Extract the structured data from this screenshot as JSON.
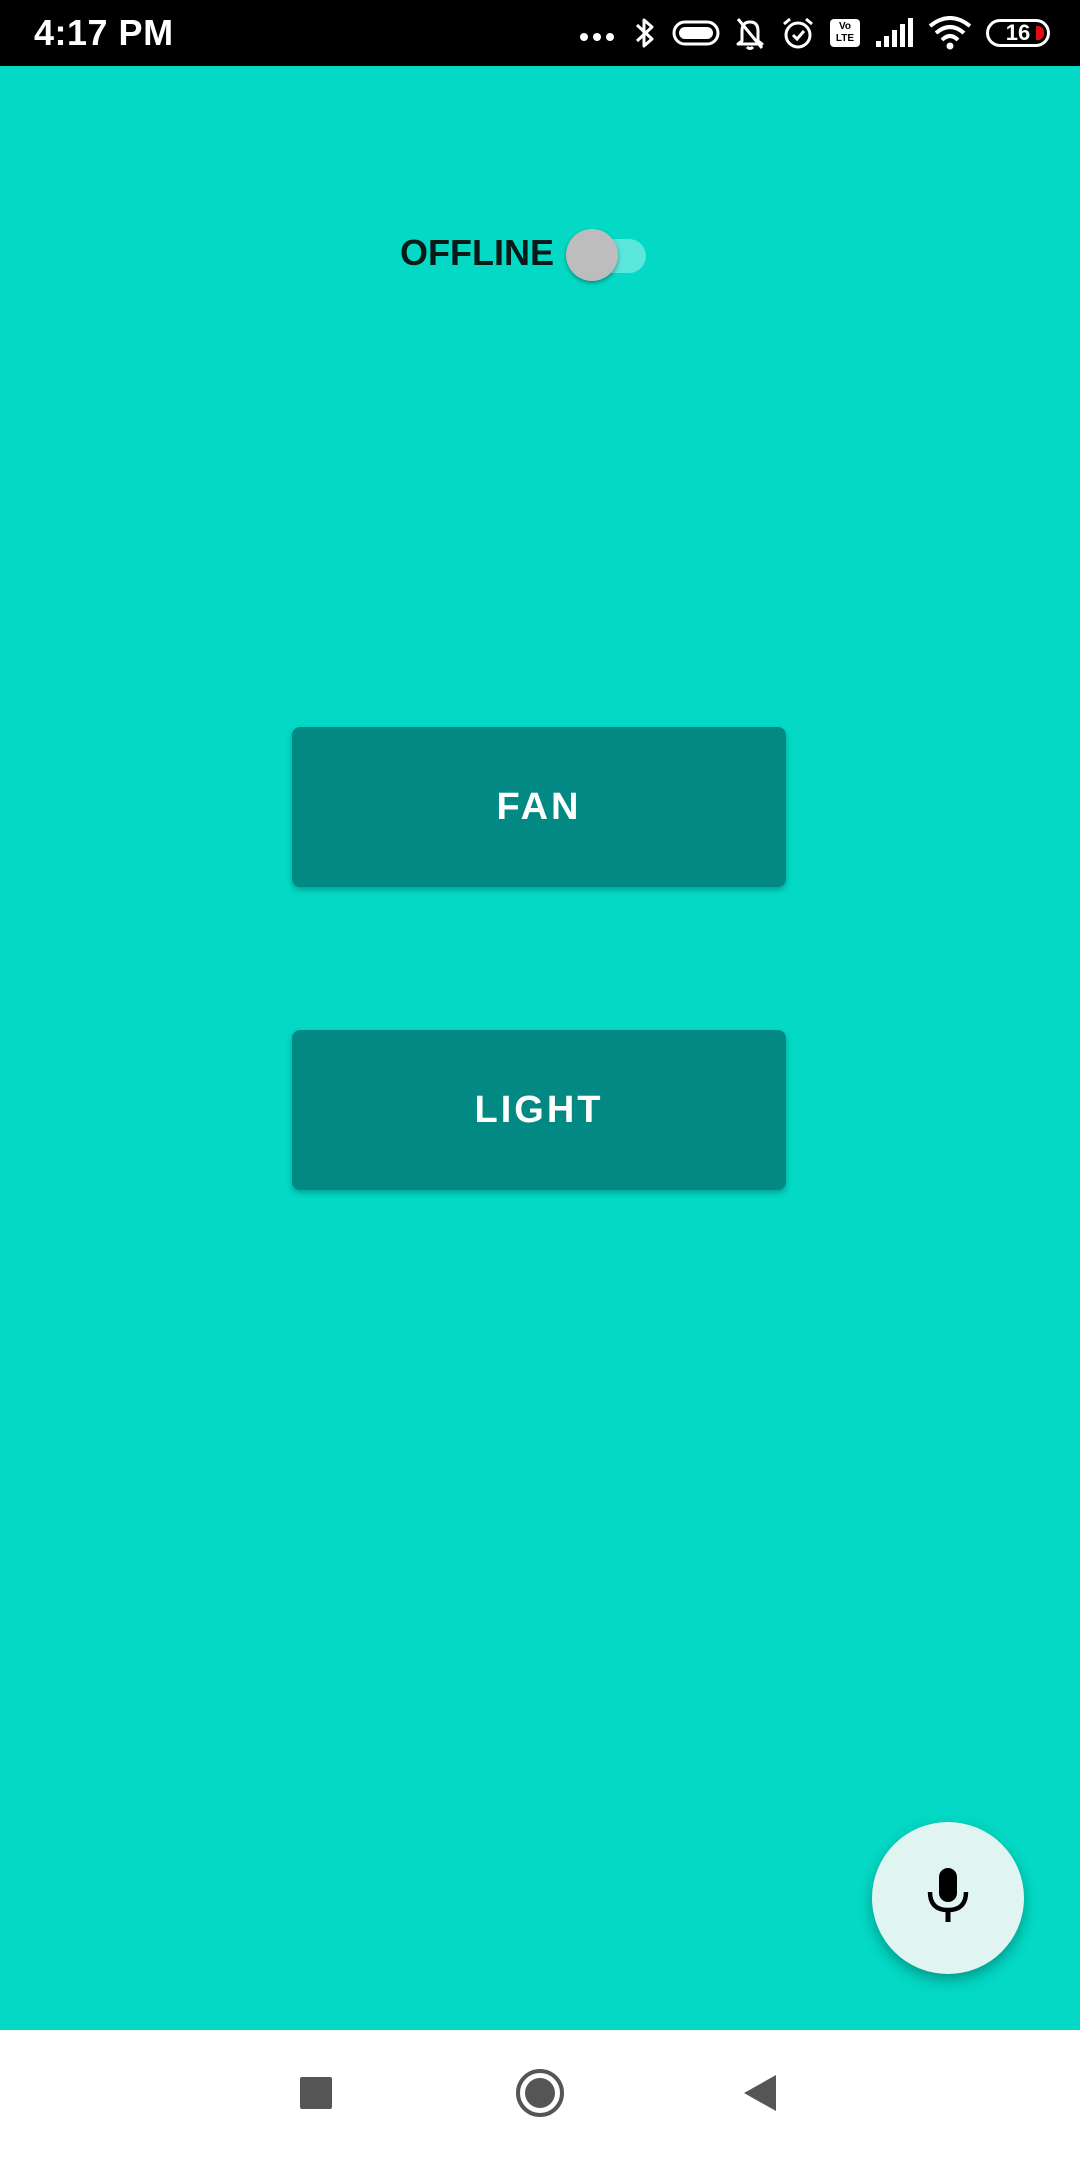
{
  "status_bar": {
    "time": "4:17 PM",
    "battery_level": "16",
    "volte_top": "Vo",
    "volte_bottom": "LTE",
    "icons": [
      "more-dots-icon",
      "bluetooth-icon",
      "toggle-pill-icon",
      "bell-off-icon",
      "alarm-icon",
      "volte-icon",
      "signal-icon",
      "wifi-icon",
      "battery-icon"
    ]
  },
  "toggle": {
    "label": "OFFLINE",
    "state": "off"
  },
  "buttons": {
    "fan": "FAN",
    "light": "LIGHT"
  },
  "fab": {
    "icon": "microphone-icon"
  },
  "nav_bar": {
    "icons": [
      "recents-square-icon",
      "home-circle-icon",
      "back-triangle-icon"
    ]
  },
  "colors": {
    "background": "#03d9c5",
    "button": "#028984",
    "button_text": "#ffffff",
    "fab_background": "#e0f5f2",
    "toggle_thumb": "#bdbdbd",
    "toggle_track": "#5be7dc",
    "status_bar": "#000000",
    "nav_bar": "#ffffff",
    "nav_icon": "#555555"
  }
}
